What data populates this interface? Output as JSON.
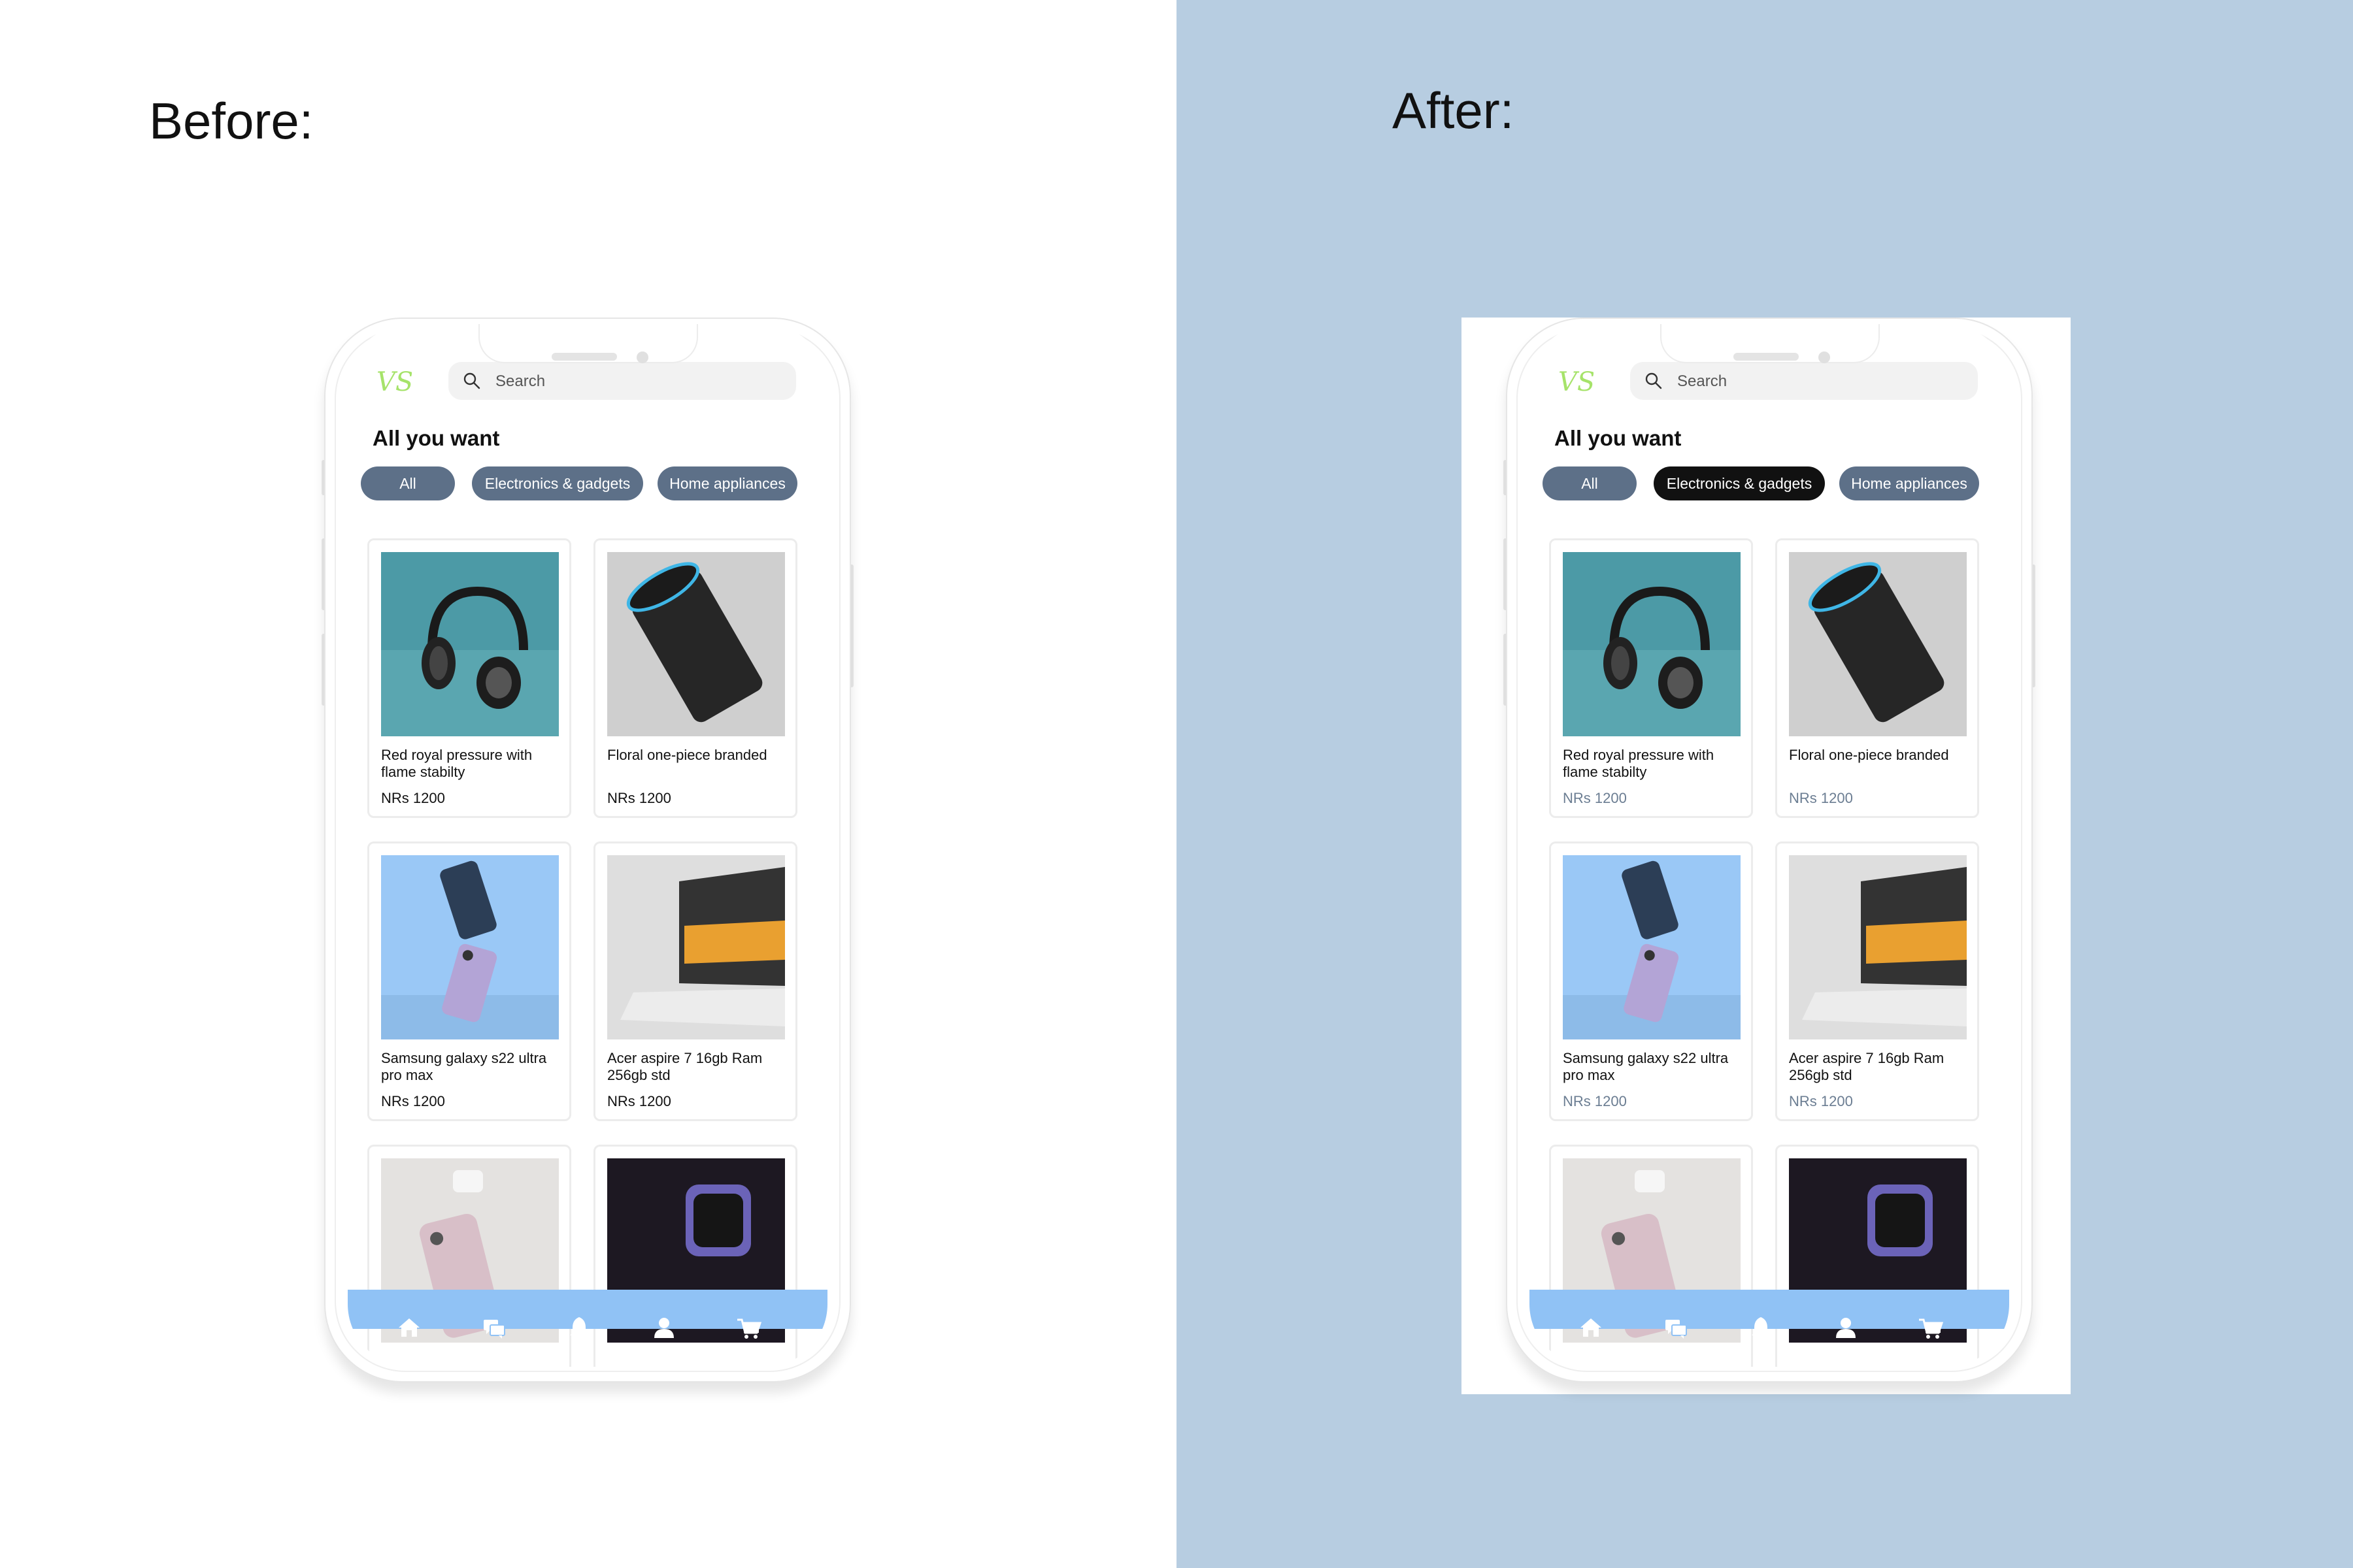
{
  "labels": {
    "before": "Before:",
    "after": "After:"
  },
  "app": {
    "search_placeholder": "Search",
    "title": "All you want",
    "chips": [
      "All",
      "Electronics & gadgets",
      "Home appliances"
    ],
    "products": [
      {
        "name": "Red royal pressure with flame stabilty",
        "price": "NRs 1200",
        "image": "headphones"
      },
      {
        "name": "Floral one-piece branded",
        "price": "NRs 1200",
        "image": "smart-speaker"
      },
      {
        "name": "Samsung galaxy s22 ultra pro max",
        "price": "NRs 1200",
        "image": "phone"
      },
      {
        "name": "Acer aspire 7 16gb Ram 256gb std",
        "price": "NRs 1200",
        "image": "laptop"
      },
      {
        "name": "",
        "price": "",
        "image": "phone-earbuds"
      },
      {
        "name": "",
        "price": "",
        "image": "smartwatch"
      }
    ],
    "nav_icons": [
      "home-icon",
      "chat-icon",
      "bell-icon",
      "user-icon",
      "cart-icon"
    ]
  },
  "state": {
    "before": {
      "active_chip": "All"
    },
    "after": {
      "active_chip": "Electronics & gadgets"
    }
  },
  "colors": {
    "page_left": "#ffffff",
    "page_right": "#b7cde1",
    "chip": "#5d7088",
    "chip_active": "#111111",
    "nav_bar": "#90c2f5",
    "logo": "#a6e36a",
    "price_after": "#6b7d92"
  }
}
